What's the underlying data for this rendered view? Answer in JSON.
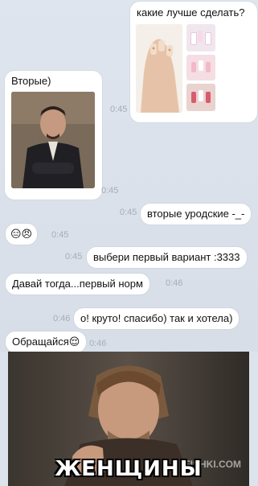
{
  "messages": {
    "m1_text": "какие лучше сделать?",
    "m2_text": "Вторые)",
    "m2_time": "0:45",
    "m2b_time": "0:45",
    "m2c_time": "0:45",
    "m3_text": "вторые уродские -_-",
    "m3_time": "0:45",
    "m4_emoji": "😑😠",
    "m4_time": "0:45",
    "m5_text": "выбери первый вариант :3333",
    "m5_time": "0:45",
    "m6_text": "Давай тогда...первый норм",
    "m6_time": "0:46",
    "m7_text": "о! круто! спасибо) так и хотела)",
    "m7_time": "0:46",
    "m8_text": "Обращайся😌",
    "m8_time": "0:46"
  },
  "meme": {
    "caption": "ЖЕНЩИНЫ",
    "watermark": "FISHKI.COM"
  },
  "colors": {
    "background": "#dde3ec",
    "bubble": "#ffffff",
    "timestamp": "#a6adb8"
  }
}
